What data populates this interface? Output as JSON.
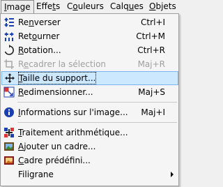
{
  "menubar": {
    "image": "Image",
    "effets": "Effets",
    "couleurs": "Couleurs",
    "calques": "Calques",
    "objets": "Objets"
  },
  "menu": {
    "renverser": {
      "label": "Renverser",
      "shortcut": "Ctrl+I",
      "icon": "flip-vertical-icon"
    },
    "retourner": {
      "label": "Retourner",
      "shortcut": "Ctrl+M",
      "icon": "flip-horizontal-icon"
    },
    "rotation": {
      "label": "Rotation...",
      "shortcut": "Ctrl+R",
      "icon": "rotate-icon"
    },
    "recadrer": {
      "label": "Recadrer la sélection",
      "shortcut": "Maj+R",
      "icon": "crop-icon",
      "disabled": true
    },
    "taille_support": {
      "label": "Taille du support...",
      "shortcut": "",
      "icon": "canvas-size-icon",
      "highlighted": true
    },
    "redimensionner": {
      "label": "Redimensionner...",
      "shortcut": "Maj+S",
      "icon": "resize-icon"
    },
    "informations": {
      "label": "Informations sur l'image...",
      "shortcut": "Maj+I",
      "icon": "info-icon"
    },
    "traitement": {
      "label": "Traitement arithmétique...",
      "shortcut": "",
      "icon": "arithmetic-icon"
    },
    "ajouter_cadre": {
      "label": "Ajouter un cadre...",
      "shortcut": "",
      "icon": "add-frame-icon"
    },
    "cadre_predefini": {
      "label": "Cadre prédéfini...",
      "shortcut": "",
      "icon": "predefined-frame-icon"
    },
    "filigrane": {
      "label": "Filigrane",
      "shortcut": "",
      "icon": "",
      "submenu": true
    }
  },
  "colors": {
    "highlight_bg": "#cce8ff",
    "highlight_border": "#7ab4e8",
    "disabled_text": "#a0a0a0"
  }
}
